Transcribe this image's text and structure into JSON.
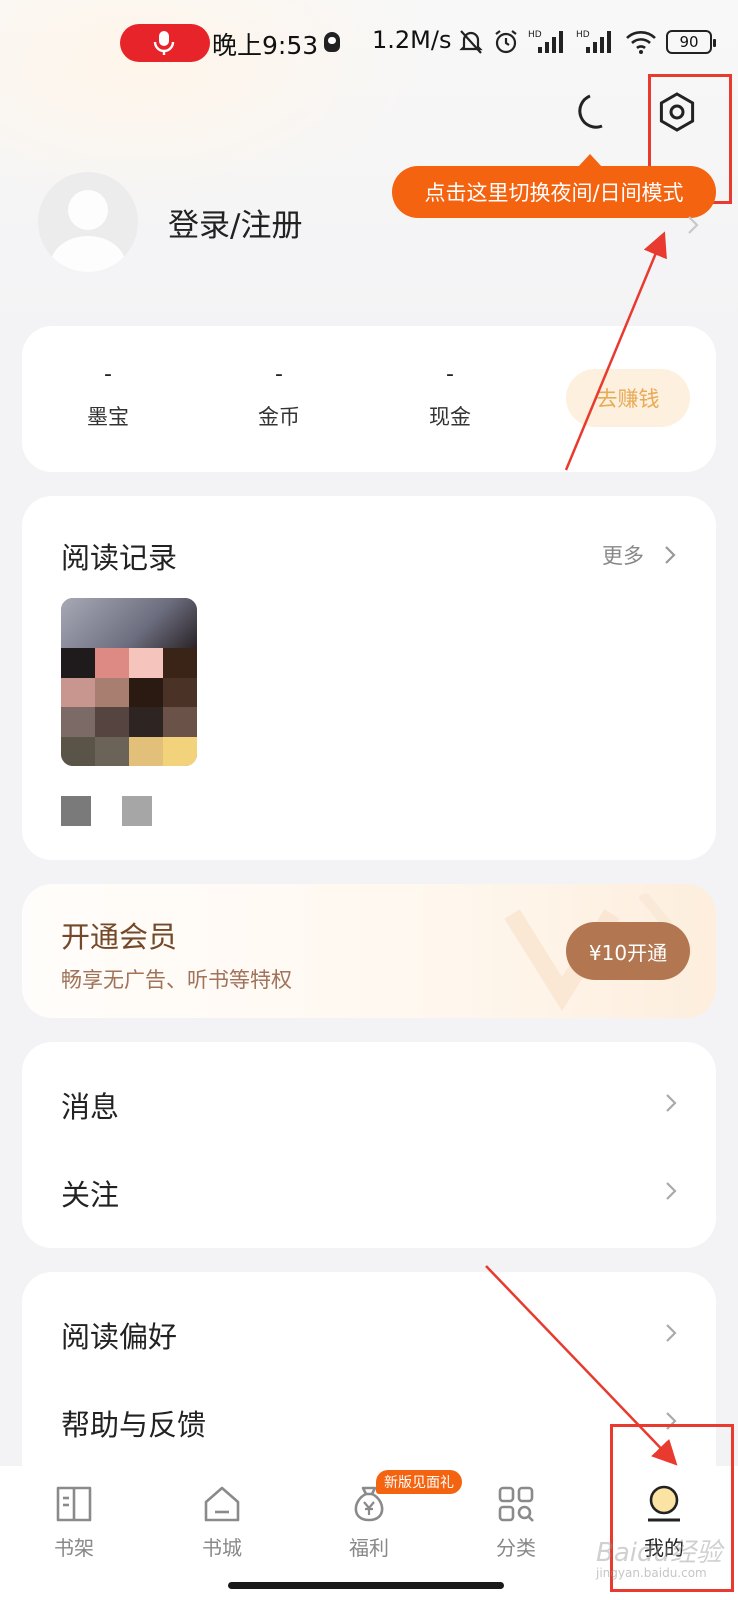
{
  "status_bar": {
    "time": "晚上9:53",
    "speed": "1.2M/s",
    "battery": "90",
    "hd1": "HD",
    "hd2": "HD"
  },
  "header": {
    "tooltip": "点击这里切换夜间/日间模式",
    "login_label": "登录/注册"
  },
  "stats": [
    {
      "value": "-",
      "label": "墨宝"
    },
    {
      "value": "-",
      "label": "金币"
    },
    {
      "value": "-",
      "label": "现金"
    }
  ],
  "earn_button": "去赚钱",
  "reading": {
    "title": "阅读记录",
    "more": "更多"
  },
  "vip": {
    "title": "开通会员",
    "subtitle": "畅享无广告、听书等特权",
    "button": "¥10开通"
  },
  "menu_group1": [
    "消息",
    "关注"
  ],
  "menu_group2": [
    "阅读偏好",
    "帮助与反馈"
  ],
  "nav": {
    "badge": "新版见面礼",
    "tabs": [
      "书架",
      "书城",
      "福利",
      "分类",
      "我的"
    ]
  },
  "watermark": {
    "main": "Baidu经验",
    "sub": "jingyan.baidu.com"
  },
  "colors": {
    "accent": "#f4630f",
    "annotation_red": "#e83a2e",
    "vip_brown": "#b27650",
    "earn_bg": "#fdf0de",
    "earn_text": "#e8aa55"
  }
}
